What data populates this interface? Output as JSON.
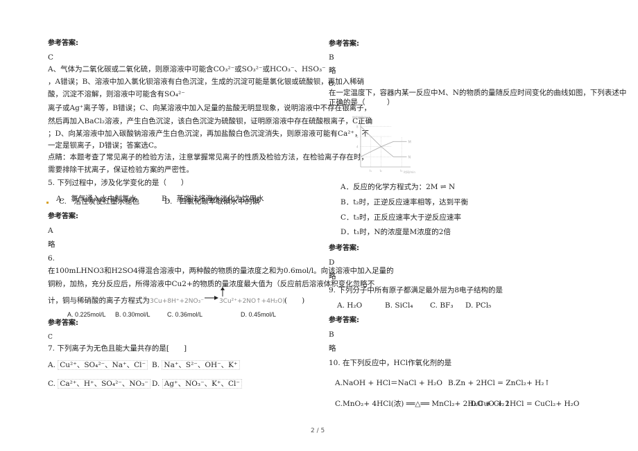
{
  "page": {
    "number": "2 / 5"
  },
  "left": {
    "answer_label_1": "参考答案:",
    "answer_1": "C",
    "explain_lines": [
      "A、气体为二氧化碳或二氧化硫，则原溶液中可能含CO₃²⁻或SO₃²⁻或HCO₃⁻、HSO₃⁻",
      "，A错误；B、溶液中加入氯化钡溶液有白色沉淀，生成的沉淀可能是氯化银或硫酸钡，再加入稀硝",
      "酸，沉淀不溶解，则溶液中可能含有SO₄²⁻",
      "离子或Ag⁺离子等，B错误；C、向某溶液中加入足量的盐酸无明显现象，说明溶液中不存在银离子，",
      "然后再加入BaCl₂溶液，产生白色沉淀，该白色沉淀为硫酸钡，证明原溶液中存在硫酸根离子，C正确",
      "；D、向某溶液中加入碳酸钠溶液产生白色沉淀，再加盐酸白色沉淀消失，则原溶液可能有Ca²⁺，不",
      "一定是钡离子，D错误；答案选C。",
      "点睛：本题考查了常见离子的检验方法，注意掌握常见离子的性质及检验方法，在检验离子存在时，",
      "需要排除干扰离子，保证检验方案的严密性。"
    ],
    "q5": {
      "stem": "5. 下列过程中，涉及化学变化的是（　　）",
      "options": [
        "A.　氯气通入水中制氯水",
        "B.　蒸馏法将海水淡化为饮用水",
        "C.　活性炭使红墨水褪色",
        "D.　四氯化碳萃取碘水中的碘"
      ]
    },
    "answer_label_2": "参考答案:",
    "answer_2": "A",
    "note_2": "略",
    "q6": {
      "number": "6.",
      "lines": [
        "在100mLHNO3和H2SO4得混合溶液中，两种酸的物质的量浓度之和为0.6mol/l。向该溶液中加入足量的",
        "铜粉，加热，充分反应后，所得溶液中Cu2+的物质的量浓度最大值为（反应前后溶液体积变化忽略不",
        "计，铜与稀硝酸的离子方程式为"
      ],
      "equation_left": "3Cu+8H⁺+2NO₃⁻",
      "equation_right": "3Cu²⁺+2NO↑+4H₂O)",
      "blank": "(　　)",
      "options": [
        "A.  0.225mol/L",
        "B.  0.30mol/L",
        "C.  0.36mol/L",
        "D.  0.45mol/L"
      ]
    },
    "answer_label_3": "参考答案:",
    "answer_3": "C",
    "q7": {
      "stem": "7. 下列离子为无色且能大量共存的是[　　]",
      "options": [
        {
          "label": "A.",
          "ions": "Cu²⁺、SO₄²⁻、Na⁺、Cl⁻"
        },
        {
          "label": "B.",
          "ions": "Na⁺、S²⁻、OH⁻、K⁺"
        },
        {
          "label": "C.",
          "ions": "Ca²⁺、H⁺、SO₄²⁻、NO₃⁻"
        },
        {
          "label": "D.",
          "ions": "Ag⁺、NO₃⁻、K⁺、Cl⁻"
        }
      ]
    }
  },
  "right": {
    "answer_label_1": "参考答案:",
    "answer_1": "B",
    "note_1": "略",
    "q8": {
      "number": "8.",
      "lines": [
        "在一定温度下，容器内某一反应中M、N的物质的量随反应时间变化的曲线如图，下列表述中",
        "正确的是（　　　）"
      ],
      "options": [
        "A．反应的化学方程式为：2M ⇌ N",
        "B．t₂时，正逆反应速率相等，达到平衡",
        "C．t₃时，正反应速率大于逆反应速率",
        "D．t₁时，N的浓度是M浓度的2倍"
      ]
    },
    "answer_label_2": "参考答案:",
    "answer_2": "D",
    "note_2": "略",
    "q9": {
      "stem": "9. 下列分子中所有原子都满足最外层为8电子结构的是",
      "options": [
        "A. H₂O",
        "B. SiCl₄",
        "C. BF₃",
        "D. PCl₅"
      ]
    },
    "answer_label_3": "参考答案:",
    "answer_3": "B",
    "note_3": "略",
    "q10": {
      "stem": "10. 在下列反应中，HCl作氧化剂的是",
      "options": [
        "A.NaOH + HCl＝NaCl + H₂O",
        "B.Zn + 2HCl = ZnCl₂+ H₂↑",
        "C.MnO₂+ 4HCl(浓) ══△══ MnCl₂+ 2H₂O + Cl₂↑",
        "D.CuO + 2HCl = CuCl₂+ H₂O"
      ]
    }
  },
  "chart_data": {
    "type": "line",
    "title": "",
    "ylabel": "物质的量/mol",
    "xlabel": "时间/min",
    "yticks": [
      "8",
      "6",
      "4",
      "2"
    ],
    "xticks": [
      "t₁",
      "t₂",
      "t₃"
    ],
    "ylim": [
      0,
      9
    ],
    "series": [
      {
        "name": "N",
        "points": [
          [
            0,
            8
          ],
          [
            1,
            6
          ],
          [
            2,
            4
          ],
          [
            3,
            2
          ],
          [
            4,
            2
          ]
        ]
      },
      {
        "name": "M",
        "points": [
          [
            0,
            2
          ],
          [
            1,
            3
          ],
          [
            2,
            4
          ],
          [
            3,
            5
          ],
          [
            4,
            5
          ]
        ]
      }
    ]
  }
}
